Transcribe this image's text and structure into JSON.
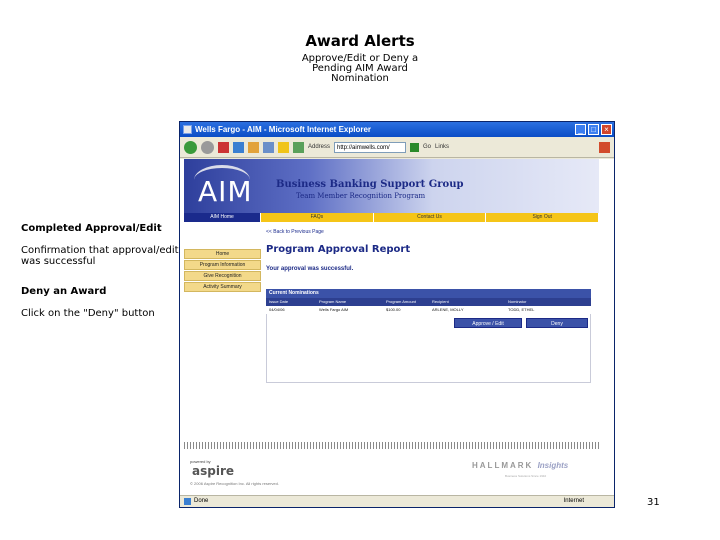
{
  "slide": {
    "title": "Award Alerts",
    "subtitle": "Approve/Edit or Deny a Pending AIM Award Nomination",
    "page_number": "31"
  },
  "notes": [
    {
      "heading": "Completed Approval/Edit",
      "body": "Confirmation that approval/edit was successful"
    },
    {
      "heading": "Deny an Award",
      "body": "Click on the \"Deny\" button"
    }
  ],
  "browser": {
    "title": "Wells Fargo - AIM - Microsoft Internet Explorer",
    "address_label": "Address",
    "address_value": "http://aimwells.com/",
    "go_label": "Go",
    "links_label": "Links",
    "status": "Done",
    "zone": "Internet"
  },
  "site": {
    "logo": "AIM",
    "header": "Business Banking Support Group",
    "subheader": "Team Member Recognition Program",
    "top_nav": [
      "AIM Home",
      "FAQs",
      "Contact Us",
      "Sign Out"
    ],
    "side_nav": [
      "Home",
      "Program Information",
      "Give Recognition",
      "Activity Summary"
    ],
    "back_link": "<< Back to Previous Page",
    "report_title": "Program Approval Report",
    "success_message": "Your approval was successful.",
    "table": {
      "heading": "Current Nominations",
      "columns": [
        "Issue Date",
        "Program Name",
        "Program Amount",
        "Recipient",
        "Nominator"
      ],
      "rows": [
        [
          "04/04/06",
          "Wells Fargo AIM",
          "$100.00",
          "ARLENE, MOLLY",
          "TODD, ETHEL"
        ]
      ],
      "approve_label": "Approve / Edit",
      "deny_label": "Deny"
    },
    "powered_by": "powered by",
    "aspire": "aspire",
    "copyright": "© 2006 Aspire Recognition Inc. All rights reserved.",
    "hallmark": "HALLMARK",
    "insights": "Insights",
    "hallmark_sub": "Business Solutions Since 1910"
  },
  "colors": {
    "banner_blue": "#2e3f9c",
    "nav_yellow": "#f5c518",
    "table_header": "#3b52a8",
    "title_bar": "#0a4dc6"
  }
}
